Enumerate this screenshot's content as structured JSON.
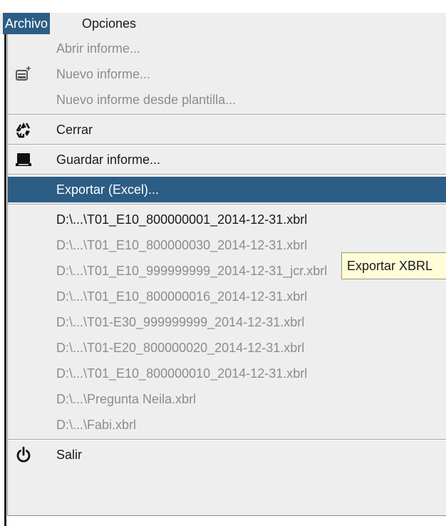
{
  "menubar": {
    "items": [
      {
        "label": "Archivo",
        "active": true
      },
      {
        "label": "Opciones",
        "active": false
      }
    ]
  },
  "menu": {
    "group1": [
      {
        "label": "Abrir informe...",
        "enabled": false,
        "icon": ""
      },
      {
        "label": "Nuevo informe...",
        "enabled": false,
        "icon": "new-document-icon"
      },
      {
        "label": "Nuevo informe desde plantilla...",
        "enabled": false,
        "icon": ""
      }
    ],
    "close": {
      "label": "Cerrar",
      "enabled": true,
      "icon": "recycle-icon"
    },
    "save": {
      "label": "Guardar informe...",
      "enabled": true,
      "icon": "save-icon"
    },
    "export": {
      "label": "Exportar (Excel)...",
      "enabled": true,
      "selected": true
    },
    "recent_files": [
      {
        "label": "D:\\...\\T01_E10_800000001_2014-12-31.xbrl",
        "enabled": true
      },
      {
        "label": "D:\\...\\T01_E10_800000030_2014-12-31.xbrl",
        "enabled": false
      },
      {
        "label": "D:\\...\\T01_E10_999999999_2014-12-31_jcr.xbrl",
        "enabled": false
      },
      {
        "label": "D:\\...\\T01_E10_800000016_2014-12-31.xbrl",
        "enabled": false
      },
      {
        "label": "D:\\...\\T01-E30_999999999_2014-12-31.xbrl",
        "enabled": false
      },
      {
        "label": "D:\\...\\T01-E20_800000020_2014-12-31.xbrl",
        "enabled": false
      },
      {
        "label": "D:\\...\\T01_E10_800000010_2014-12-31.xbrl",
        "enabled": false
      },
      {
        "label": "D:\\...\\Pregunta Neila.xbrl",
        "enabled": false
      },
      {
        "label": "D:\\...\\Fabi.xbrl",
        "enabled": false
      }
    ],
    "exit": {
      "label": "Salir",
      "enabled": true,
      "icon": "power-icon"
    }
  },
  "tooltip": {
    "text": "Exportar XBRL"
  },
  "colors": {
    "menu_bg": "#eeeeee",
    "selection": "#2c5d85",
    "disabled_text": "#8c8c8c",
    "tooltip_bg": "#fffcd8"
  }
}
